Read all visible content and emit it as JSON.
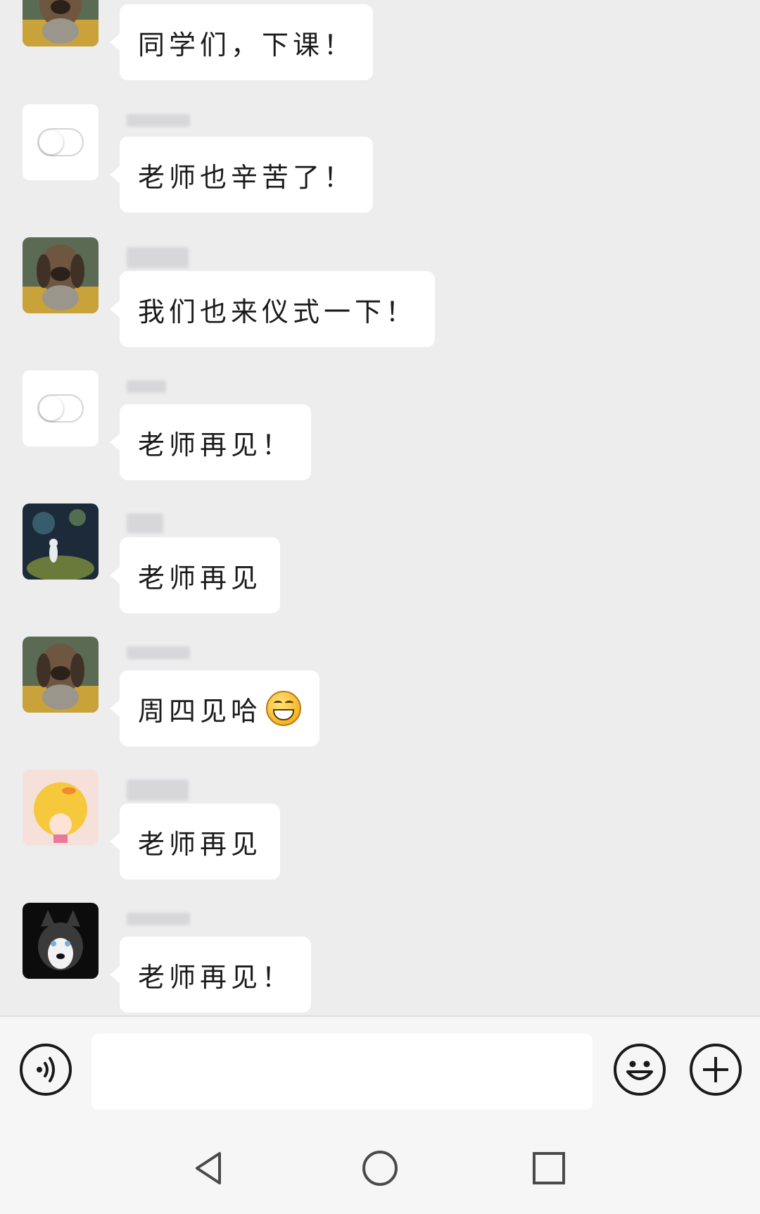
{
  "messages": [
    {
      "text": "同学们，下课！",
      "avatar": "dog-statue-avatar"
    },
    {
      "text": "老师也辛苦了！",
      "avatar": "toggle-avatar"
    },
    {
      "text": "我们也来仪式一下！",
      "avatar": "dog-statue-avatar"
    },
    {
      "text": "老师再见！",
      "avatar": "toggle-avatar"
    },
    {
      "text": "老师再见",
      "avatar": "night-sky-avatar"
    },
    {
      "text": "周四见哈",
      "avatar": "dog-statue-avatar",
      "emoji": "grinning-face-emoji"
    },
    {
      "text": "老师再见",
      "avatar": "duck-girl-avatar"
    },
    {
      "text": "老师再见！",
      "avatar": "husky-avatar"
    }
  ],
  "input_bar": {
    "text_value": "",
    "icons": [
      "voice-icon",
      "emoji-icon",
      "plus-icon"
    ]
  },
  "nav_bar": {
    "icons": [
      "back-icon",
      "home-icon",
      "recents-icon"
    ]
  },
  "colors": {
    "background": "#ededee",
    "bubble": "#ffffff",
    "icon": "#1a1a1a"
  }
}
